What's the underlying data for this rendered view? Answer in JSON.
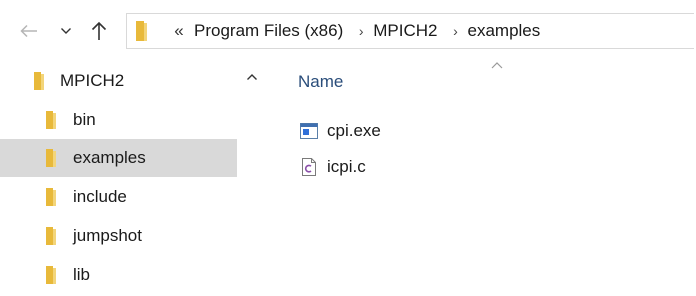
{
  "navigation": {
    "back_icon": "back-arrow-icon",
    "recent_icon": "chevron-down-icon",
    "up_icon": "up-arrow-icon"
  },
  "address_bar": {
    "overflow": "«",
    "crumbs": [
      {
        "label": "Program Files (x86)"
      },
      {
        "label": "MPICH2"
      },
      {
        "label": "examples"
      }
    ],
    "separator": "›"
  },
  "nav_pane": {
    "items": [
      {
        "label": "MPICH2",
        "selected": false
      },
      {
        "label": "bin",
        "selected": false
      },
      {
        "label": "examples",
        "selected": true
      },
      {
        "label": "include",
        "selected": false
      },
      {
        "label": "jumpshot",
        "selected": false
      },
      {
        "label": "lib",
        "selected": false
      }
    ]
  },
  "content": {
    "column_header": "Name",
    "sort": "ascending",
    "files": [
      {
        "name": "cpi.exe",
        "icon": "application-icon"
      },
      {
        "name": "icpi.c",
        "icon": "c-source-file-icon"
      }
    ]
  },
  "colors": {
    "folder_yellow": "#e8b93a",
    "selection_gray": "#d9d9d9",
    "header_blue": "#2a4d7a"
  }
}
